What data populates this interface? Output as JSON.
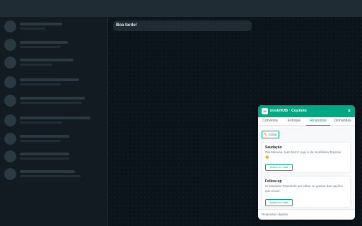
{
  "chat": {
    "greeting": "Boa tarde!"
  },
  "copilot": {
    "brand_icon": "IH",
    "title": "imobHUB · Copilote",
    "close_glyph": "×",
    "tabs": [
      {
        "label": "Conversa"
      },
      {
        "label": "Estoque"
      },
      {
        "label": "Respostas"
      },
      {
        "label": "Demandas"
      }
    ],
    "active_tab": "Respostas",
    "edit_label": "✏️ Editar",
    "replies": [
      {
        "title": "Saudação",
        "text": "Olá Mariana, tudo bem? Aqui é da Imobiliária Terprise 😊",
        "insert_label": "Inserir no chat"
      },
      {
        "title": "Follow-up",
        "text": "Oi Mariana! Passando pra saber se gostou das opções que enviei.",
        "insert_label": "Inserir no chat"
      }
    ],
    "footer_label": "Respostas rápidas"
  },
  "colors": {
    "accent": "#00a884",
    "background": "#0b141a",
    "sidebar": "#111b21",
    "topbar": "#202c33"
  }
}
